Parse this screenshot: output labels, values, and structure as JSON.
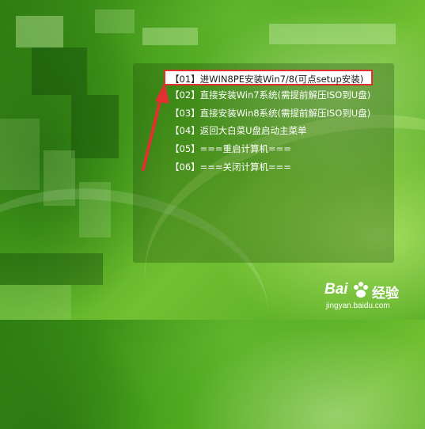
{
  "menu": {
    "items": [
      {
        "label": "【01】进WIN8PE安装Win7/8(可点setup安装)",
        "selected": true
      },
      {
        "label": "【02】直接安装Win7系统(需提前解压ISO到U盘)"
      },
      {
        "label": "【03】直接安装Win8系统(需提前解压ISO到U盘)"
      },
      {
        "label": "【04】返回大白菜U盘启动主菜单"
      },
      {
        "label": "【05】===重启计算机==="
      },
      {
        "label": "【06】===关闭计算机==="
      }
    ]
  },
  "watermark": {
    "brand_left": "Bai",
    "brand_right": "经验",
    "url": "jingyan.baidu.com"
  },
  "colors": {
    "highlight_border": "#e03030",
    "annotation_arrow": "#e03030",
    "selected_bg": "#ffffff"
  }
}
